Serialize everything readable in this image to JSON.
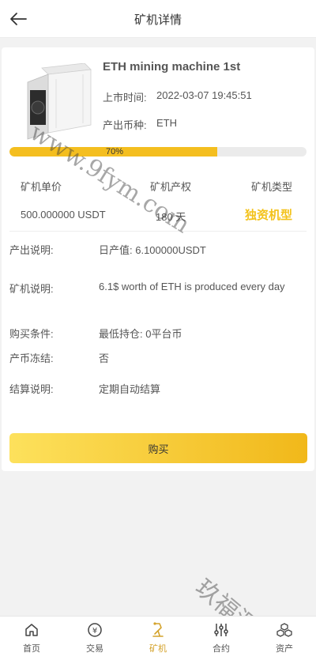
{
  "header": {
    "title": "矿机详情",
    "back_icon": "arrow-left-icon"
  },
  "product": {
    "name": "ETH mining machine 1st",
    "listing_label": "上市时间:",
    "listing_value": "2022-03-07 19:45:51",
    "coin_label": "产出币种:",
    "coin_value": "ETH",
    "image_icon": "mining-machine-image"
  },
  "progress": {
    "value": 0.7,
    "text": "70%",
    "color": "#f4be1f"
  },
  "stats": {
    "price_label": "矿机单价",
    "price_value": "500.000000 USDT",
    "term_label": "矿机产权",
    "term_value": "180 天",
    "type_label": "矿机类型",
    "type_value": "独资机型"
  },
  "details": [
    {
      "label": "产出说明:",
      "value": "日产值: 6.100000USDT"
    },
    {
      "label": "矿机说明:",
      "value": "6.1$ worth of ETH is produced every day"
    },
    {
      "label": "购买条件:",
      "value": "最低持仓: 0平台币"
    },
    {
      "label": "产币冻结:",
      "value": "否"
    },
    {
      "label": "结算说明:",
      "value": "定期自动结算"
    }
  ],
  "buy_button": {
    "label": "购买"
  },
  "tabbar": [
    {
      "label": "首页",
      "icon": "home-icon"
    },
    {
      "label": "交易",
      "icon": "yen-coin-icon"
    },
    {
      "label": "矿机",
      "icon": "mining-robot-icon",
      "active": true
    },
    {
      "label": "合约",
      "icon": "sliders-icon"
    },
    {
      "label": "资产",
      "icon": "cubes-icon"
    }
  ],
  "watermark": {
    "domain": "www.9fym.com",
    "brand": "玖福源"
  },
  "colors": {
    "accent": "#f4be1f",
    "tab_active": "#d4a22a",
    "type_text": "#f3c21a"
  }
}
